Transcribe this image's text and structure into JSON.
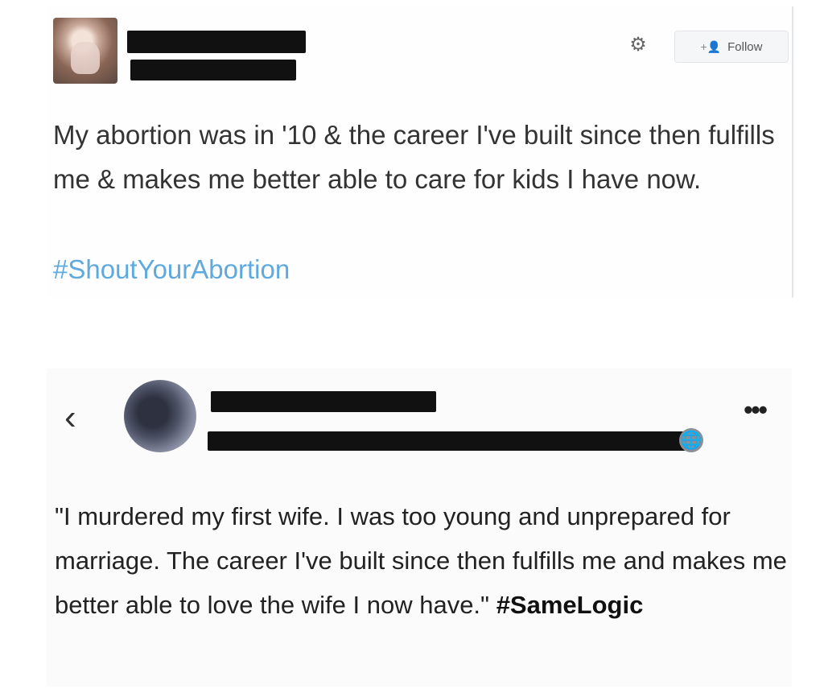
{
  "tweet": {
    "follow_label": "Follow",
    "follow_icon": "person-plus-icon",
    "gear_icon": "gear-icon",
    "text": "My abortion was in '10 & the career I've built since then fulfills me & makes me better able to care for kids I have now.",
    "hashtag": "#ShoutYourAbortion",
    "colors": {
      "hashtag": "#5ea9dd"
    }
  },
  "facebook_post": {
    "back_icon": "chevron-left-icon",
    "privacy_icon": "globe-icon",
    "more_icon": "more-options-icon",
    "text": "\"I murdered my first wife. I was too young and unprepared for marriage. The career I've built since then fulfills me and makes me better able to love the wife I now have.\"",
    "hashtag": "#SameLogic"
  }
}
